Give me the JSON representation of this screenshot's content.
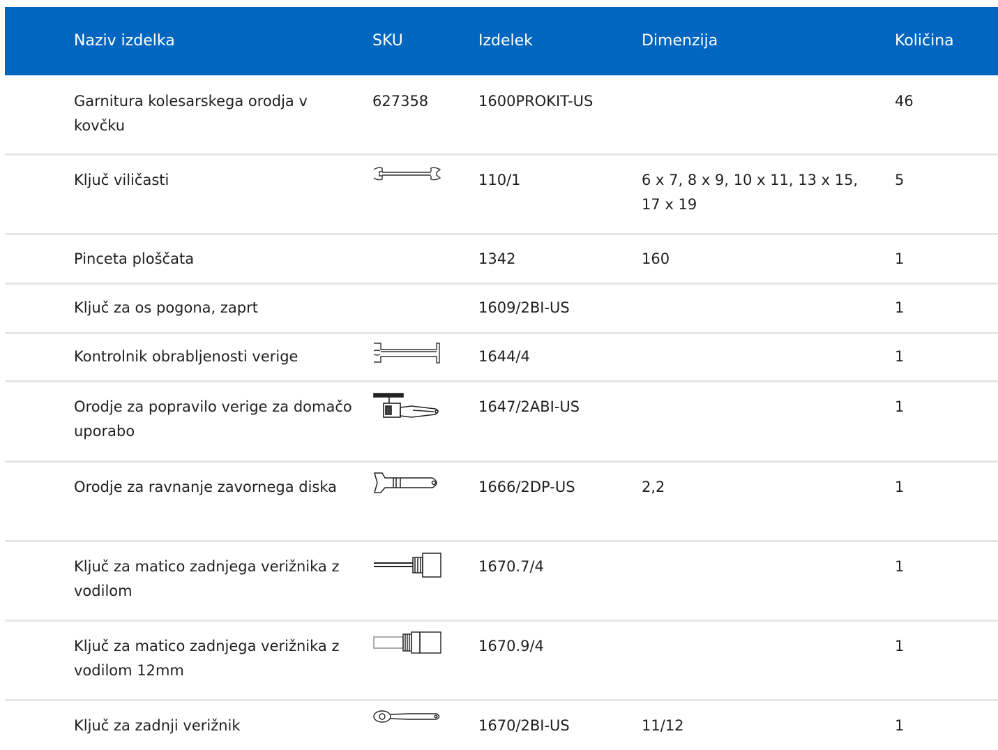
{
  "header": {
    "name": "Naziv izdelka",
    "sku": "SKU",
    "product": "Izdelek",
    "dimension": "Dimenzija",
    "quantity": "Količina"
  },
  "colors": {
    "header_bg": "#0066c0",
    "header_text": "#ffffff",
    "row_divider": "#e6e6e6"
  },
  "rows": [
    {
      "name": "Garnitura kolesarskega orodja v kovčku",
      "sku": "627358",
      "icon": "",
      "product": "1600PROKIT-US",
      "dimension": "",
      "quantity": "46"
    },
    {
      "name": "Ključ viličasti",
      "sku": "",
      "icon": "open-end-wrench-icon",
      "product": "110/1",
      "dimension": "6 x 7, 8 x 9, 10 x 11, 13 x 15, 17 x 19",
      "quantity": "5"
    },
    {
      "name": "Pinceta ploščata",
      "sku": "",
      "icon": "",
      "product": "1342",
      "dimension": "160",
      "quantity": "1"
    },
    {
      "name": "Ključ za os pogona, zaprt",
      "sku": "",
      "icon": "",
      "product": "1609/2BI-US",
      "dimension": "",
      "quantity": "1"
    },
    {
      "name": "Kontrolnik obrabljenosti verige",
      "sku": "",
      "icon": "chain-wear-gauge-icon",
      "product": "1644/4",
      "dimension": "",
      "quantity": "1"
    },
    {
      "name": "Orodje za popravilo verige za domačo uporabo",
      "sku": "",
      "icon": "chain-tool-icon",
      "product": "1647/2ABI-US",
      "dimension": "",
      "quantity": "1"
    },
    {
      "name": "Orodje za ravnanje zavornega diska",
      "sku": "",
      "icon": "disc-straightener-icon",
      "product": "1666/2DP-US",
      "dimension": "2,2",
      "quantity": "1"
    },
    {
      "name": "Ključ za matico zadnjega verižnika z vodilom",
      "sku": "",
      "icon": "cassette-tool-guide-icon",
      "product": "1670.7/4",
      "dimension": "",
      "quantity": "1"
    },
    {
      "name": "Ključ za matico zadnjega verižnika z vodilom 12mm",
      "sku": "",
      "icon": "cassette-tool-12mm-icon",
      "product": "1670.9/4",
      "dimension": "",
      "quantity": "1"
    },
    {
      "name": "Ključ za zadnji verižnik",
      "sku": "",
      "icon": "chain-whip-icon",
      "product": "1670/2BI-US",
      "dimension": "11/12",
      "quantity": "1"
    }
  ]
}
